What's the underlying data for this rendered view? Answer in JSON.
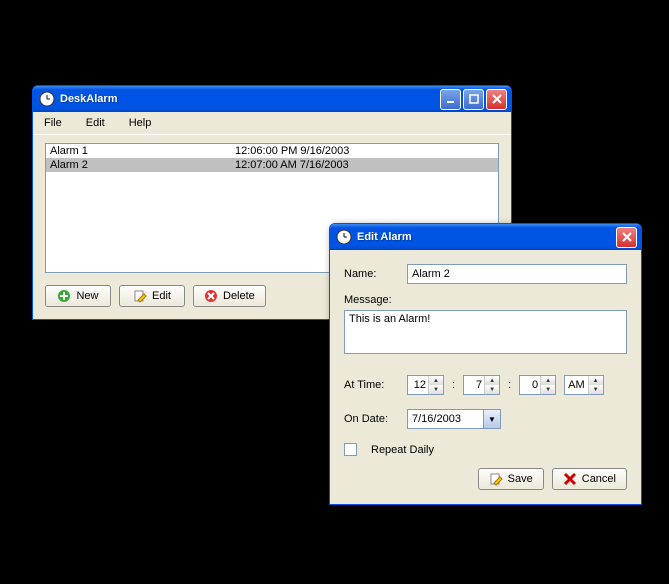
{
  "main": {
    "title": "DeskAlarm",
    "menu": {
      "file": "File",
      "edit": "Edit",
      "help": "Help"
    },
    "alarms": [
      {
        "name": "Alarm 1",
        "time": "12:06:00 PM 9/16/2003"
      },
      {
        "name": "Alarm 2",
        "time": "12:07:00 AM 7/16/2003"
      }
    ],
    "buttons": {
      "new": "New",
      "edit": "Edit",
      "delete": "Delete"
    }
  },
  "dialog": {
    "title": "Edit Alarm",
    "labels": {
      "name": "Name:",
      "message": "Message:",
      "attime": "At Time:",
      "ondate": "On Date:",
      "repeat": "Repeat Daily"
    },
    "values": {
      "name": "Alarm 2",
      "message": "This is an Alarm!",
      "hour": "12",
      "minute": "7",
      "second": "0",
      "ampm": "AM",
      "date": "7/16/2003"
    },
    "buttons": {
      "save": "Save",
      "cancel": "Cancel"
    }
  }
}
